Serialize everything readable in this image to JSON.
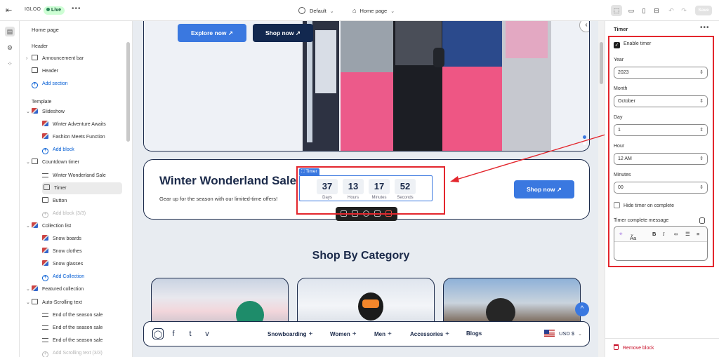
{
  "topbar": {
    "store_name": "IGLOO",
    "status": "Live",
    "theme": "Default",
    "page": "Home page",
    "save_label": "Save"
  },
  "sidebar": {
    "title": "Home page",
    "header_group": "Header",
    "header_items": [
      {
        "label": "Announcement bar",
        "icon": "layout-section-icon"
      },
      {
        "label": "Header",
        "icon": "layout-section-icon"
      }
    ],
    "header_add": "Add section",
    "template_group": "Template",
    "template_items": [
      {
        "label": "Slideshow",
        "level": 0,
        "icon": "image-icon"
      },
      {
        "label": "Winter Adventure Awaits",
        "level": 1,
        "icon": "image-icon"
      },
      {
        "label": "Fashion Meets Function",
        "level": 1,
        "icon": "image-icon"
      },
      {
        "label": "Add block",
        "level": 1,
        "add": true
      },
      {
        "label": "Countdown timer",
        "level": 0,
        "icon": "layout-section-icon"
      },
      {
        "label": "Winter Wonderland Sale",
        "level": 1,
        "icon": "text-icon"
      },
      {
        "label": "Timer",
        "level": 1,
        "icon": "timer-icon",
        "selected": true
      },
      {
        "label": "Button",
        "level": 1,
        "icon": "button-icon"
      },
      {
        "label": "Add block (3/3)",
        "level": 1,
        "add": true,
        "disabled": true
      },
      {
        "label": "Collection list",
        "level": 0,
        "icon": "image-icon"
      },
      {
        "label": "Snow boards",
        "level": 1,
        "icon": "image-icon"
      },
      {
        "label": "Snow clothes",
        "level": 1,
        "icon": "image-icon"
      },
      {
        "label": "Snow glasses",
        "level": 1,
        "icon": "image-icon"
      },
      {
        "label": "Add Collection",
        "level": 1,
        "add": true
      },
      {
        "label": "Featured collection",
        "level": 0,
        "icon": "image-icon"
      },
      {
        "label": "Auto-Scrolling text",
        "level": 0,
        "icon": "layout-section-icon"
      },
      {
        "label": "End of the season sale",
        "level": 1,
        "icon": "text-icon"
      },
      {
        "label": "End of the season sale",
        "level": 1,
        "icon": "text-icon"
      },
      {
        "label": "End of the season sale",
        "level": 1,
        "icon": "text-icon"
      },
      {
        "label": "Add Scrolling text (3/3)",
        "level": 1,
        "add": true,
        "disabled": true
      }
    ]
  },
  "preview": {
    "hero": {
      "explore_label": "Explore now",
      "shop_label": "Shop now"
    },
    "countdown": {
      "title": "Winter Wonderland Sale",
      "subtitle": "Gear up for the season with our limited-time offers!",
      "timer_tag": "Timer",
      "cells": [
        {
          "value": "37",
          "label": "Days"
        },
        {
          "value": "13",
          "label": "Hours"
        },
        {
          "value": "17",
          "label": "Minutes"
        },
        {
          "value": "52",
          "label": "Seconds"
        }
      ],
      "button_label": "Shop now"
    },
    "category_title": "Shop By Category",
    "footer_nav": [
      {
        "label": "Snowboarding",
        "plus": true
      },
      {
        "label": "Women",
        "plus": true
      },
      {
        "label": "Men",
        "plus": true
      },
      {
        "label": "Accessories",
        "plus": true
      },
      {
        "label": "Blogs",
        "plus": false
      }
    ],
    "currency": "USD $"
  },
  "panel": {
    "title": "Timer",
    "enable_label": "Enable timer",
    "enable_checked": true,
    "fields": [
      {
        "label": "Year",
        "value": "2023"
      },
      {
        "label": "Month",
        "value": "October"
      },
      {
        "label": "Day",
        "value": "1"
      },
      {
        "label": "Hour",
        "value": "12 AM"
      },
      {
        "label": "Minutes",
        "value": "00"
      }
    ],
    "hide_label": "Hide timer on complete",
    "hide_checked": false,
    "message_label": "Timer complete message",
    "rte_font": "Aa",
    "remove_label": "Remove block"
  },
  "colors": {
    "annotation": "#e3262d",
    "accent": "#3a78e0",
    "navy": "#12284f"
  }
}
